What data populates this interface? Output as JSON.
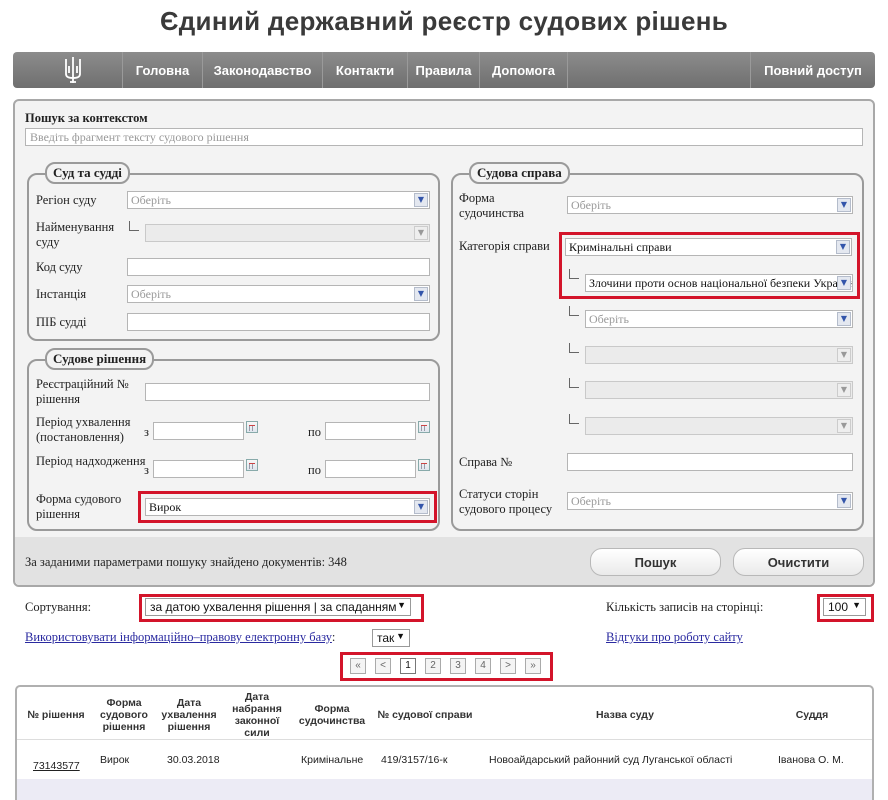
{
  "site": {
    "title": "Єдиний державний реєстр судових рішень"
  },
  "nav": {
    "items": [
      "Головна",
      "Законодавство",
      "Контакти",
      "Правила",
      "Допомога"
    ],
    "full_access": "Повний доступ"
  },
  "search": {
    "context_label": "Пошук за контекстом",
    "context_placeholder": "Введіть фрагмент тексту судового рішення"
  },
  "court": {
    "legend": "Суд та судді",
    "region_label": "Регіон суду",
    "region_value": "Оберіть",
    "name_label": "Найменування суду",
    "code_label": "Код суду",
    "instance_label": "Інстанція",
    "instance_value": "Оберіть",
    "judge_label": "ПІБ судді"
  },
  "decision": {
    "legend": "Судове рішення",
    "reg_label": "Реєстраційний № рішення",
    "period_adopt_label": "Період ухвалення (постановлення)",
    "period_receipt_label": "Період надходження",
    "from": "з",
    "to": "по",
    "form_label": "Форма судового рішення",
    "form_value": "Вирок"
  },
  "case": {
    "legend": "Судова справа",
    "form_label": "Форма судочинства",
    "form_value": "Оберіть",
    "category_label": "Категорія справи",
    "category_value": "Кримінальні справи",
    "subcategory_value": "Злочини проти основ національної безпеки України",
    "sub2_value": "Оберіть",
    "number_label": "Справа №",
    "status_label": "Статуси сторін судового процесу",
    "status_value": "Оберіть"
  },
  "results_info": {
    "found_text": "За заданими параметрами пошуку знайдено документів: 348",
    "search_button": "Пошук",
    "clear_button": "Очистити"
  },
  "sorting": {
    "label": "Сортування:",
    "value": "за датою ухвалення рішення | за спаданням",
    "per_page_label": "Кількість записів на сторінці:",
    "per_page_value": "100",
    "legal_base_link": "Використовувати інформаційно–правову електронну базу",
    "legal_base_colon": ":",
    "legal_base_value": "так",
    "feedback_link": "Відгуки про роботу сайту"
  },
  "pagination": {
    "first": "«",
    "prev": "<",
    "pages": [
      "1",
      "2",
      "3",
      "4"
    ],
    "next": ">",
    "last": "»",
    "current": "1"
  },
  "table": {
    "headers": {
      "num": "№ рішення",
      "form": "Форма судового рішення",
      "adopt": "Дата ухвалення рішення",
      "effective": "Дата набрання законної сили",
      "proc": "Форма судочинства",
      "case_no": "№ судової справи",
      "court": "Назва суду",
      "judge": "Суддя"
    },
    "rows": [
      {
        "num": "73143577",
        "form": "Вирок",
        "adopt": "30.03.2018",
        "effective": "",
        "proc": "Кримінальне",
        "case_no": "419/3157/16-к",
        "court": "Новоайдарський районний суд Луганської області",
        "judge": "Іванова О. М."
      }
    ]
  },
  "colors": {
    "highlight": "#d3142a",
    "nav_bg": "#7d7d7d",
    "link": "#2a2aa0"
  }
}
